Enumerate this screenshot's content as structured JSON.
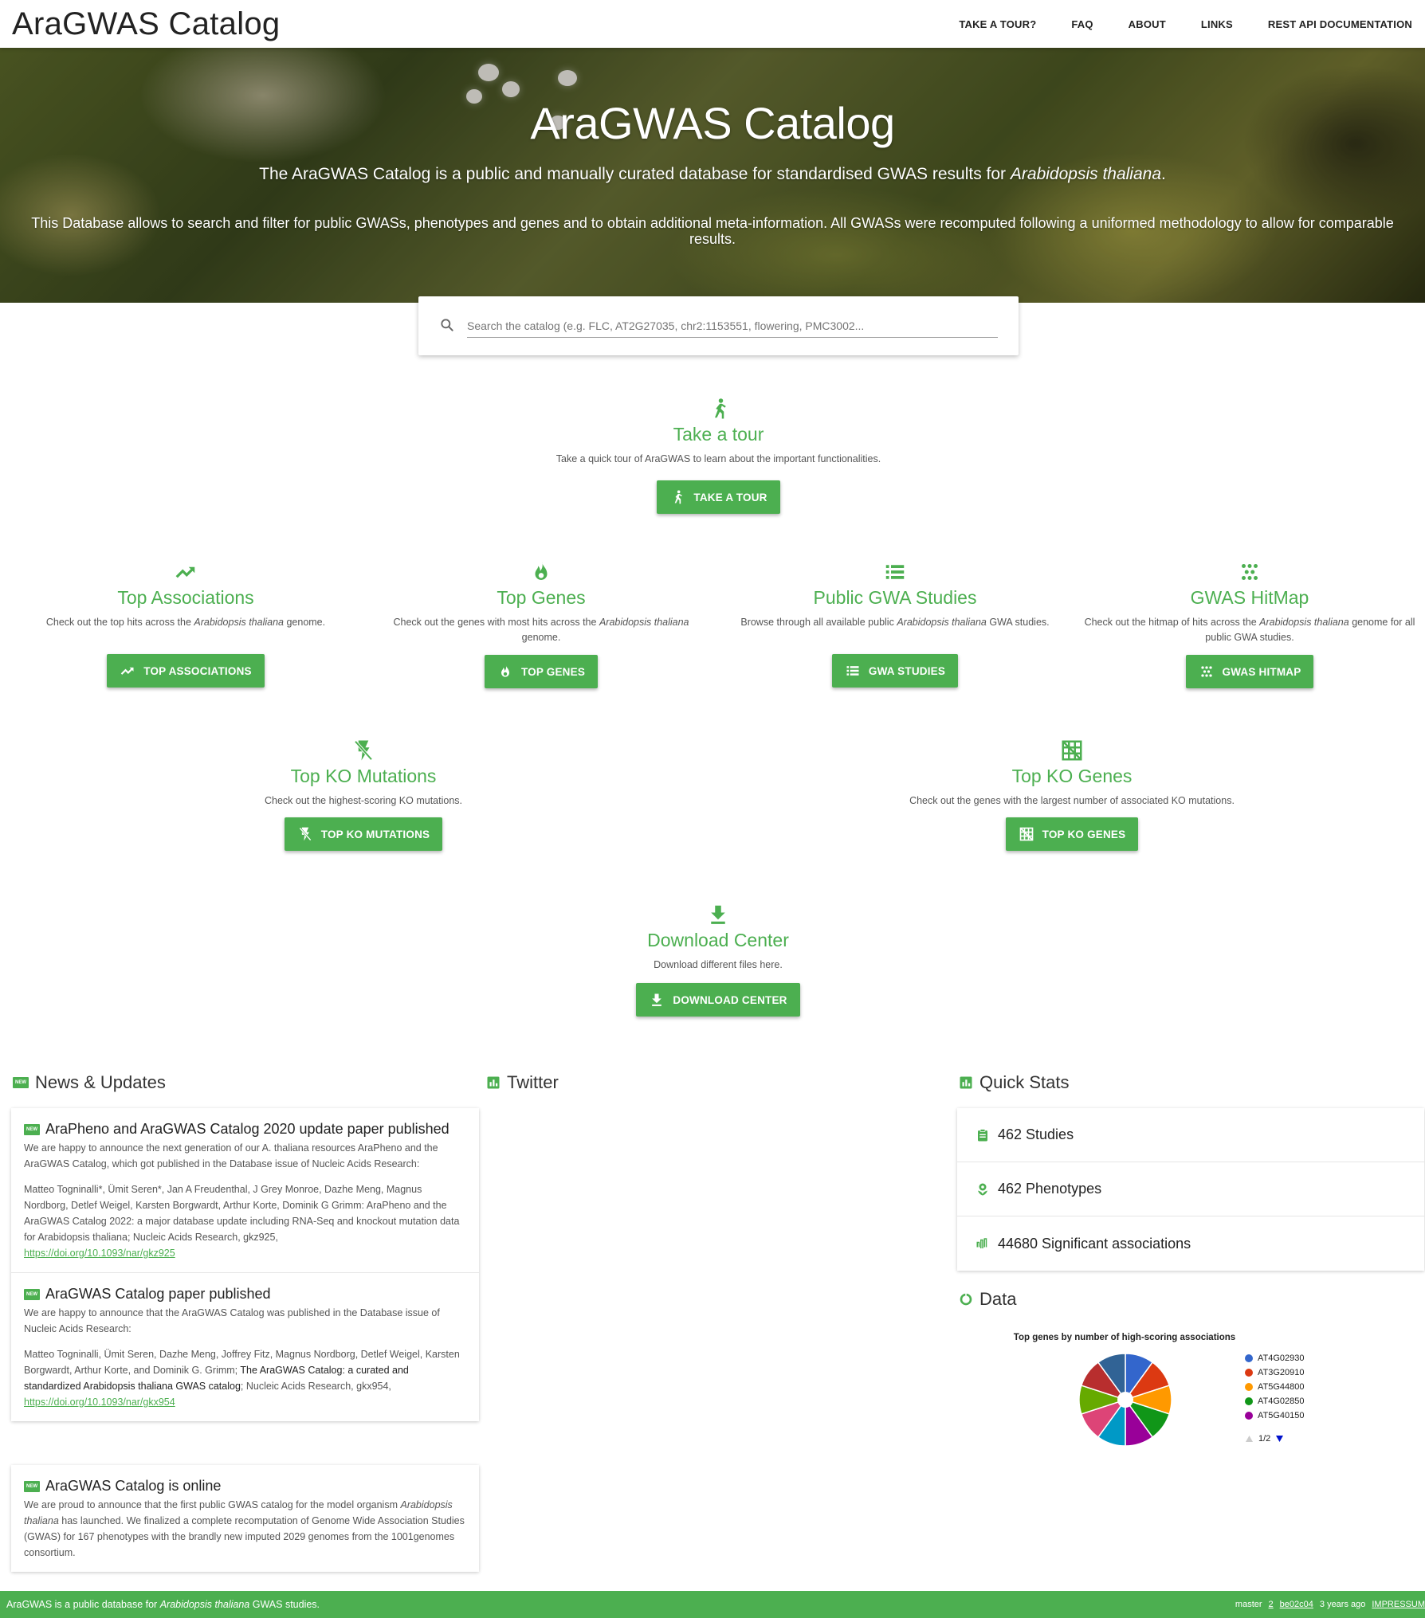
{
  "header": {
    "brand": "AraGWAS Catalog",
    "nav": [
      "TAKE A TOUR?",
      "FAQ",
      "ABOUT",
      "LINKS",
      "REST API DOCUMENTATION"
    ]
  },
  "hero": {
    "title": "AraGWAS Catalog",
    "subtitle_pre": "The AraGWAS Catalog is a public and manually curated database for standardised GWAS results for ",
    "subtitle_species": "Arabidopsis thaliana",
    "subtitle_post": ".",
    "description": "This Database allows to search and filter for public GWASs, phenotypes and genes and to obtain additional meta-information. All GWASs were recomputed following a uniformed methodology to allow for comparable results."
  },
  "search": {
    "placeholder": "Search the catalog (e.g. FLC, AT2G27035, chr2:1153551, flowering, PMC3002..."
  },
  "tour": {
    "title": "Take a tour",
    "desc": "Take a quick tour of AraGWAS to learn about the important functionalities.",
    "button": "TAKE A TOUR"
  },
  "features": [
    {
      "title": "Top Associations",
      "desc_pre": "Check out the top hits across the ",
      "desc_species": "Arabidopsis thaliana",
      "desc_post": " genome.",
      "button": "TOP ASSOCIATIONS",
      "icon": "trending-up-icon"
    },
    {
      "title": "Top Genes",
      "desc_pre": "Check out the genes with most hits across the ",
      "desc_species": "Arabidopsis thaliana",
      "desc_post": " genome.",
      "button": "TOP GENES",
      "icon": "fire-icon"
    },
    {
      "title": "Public GWA Studies",
      "desc_pre": "Browse through all available public ",
      "desc_species": "Arabidopsis thaliana",
      "desc_post": " GWA studies.",
      "button": "GWA STUDIES",
      "icon": "list-icon"
    },
    {
      "title": "GWAS HitMap",
      "desc_pre": "Check out the hitmap of hits across the ",
      "desc_species": "Arabidopsis thaliana",
      "desc_post": " genome for all public GWA studies.",
      "button": "GWAS HITMAP",
      "icon": "hitmap-icon"
    }
  ],
  "ko": [
    {
      "title": "Top KO Mutations",
      "desc": "Check out the highest-scoring KO mutations.",
      "button": "TOP KO MUTATIONS",
      "icon": "flash-off-icon"
    },
    {
      "title": "Top KO Genes",
      "desc": "Check out the genes with the largest number of associated KO mutations.",
      "button": "TOP KO GENES",
      "icon": "grid-off-icon"
    }
  ],
  "download": {
    "title": "Download Center",
    "desc": "Download different files here.",
    "button": "DOWNLOAD CENTER"
  },
  "news": {
    "heading": "News & Updates",
    "badge": "NEW",
    "items": [
      {
        "title": "AraPheno and AraGWAS Catalog 2020 update paper published",
        "intro": "We are happy to announce the next generation of our A. thaliana resources AraPheno and the AraGWAS Catalog, which got published in the Database issue of Nucleic Acids Research:",
        "citation": "Matteo Togninalli*, Ümit Seren*, Jan A Freudenthal, J Grey Monroe, Dazhe Meng, Magnus Nordborg, Detlef Weigel, Karsten Borgwardt, Arthur Korte, Dominik G Grimm: AraPheno and the AraGWAS Catalog 2022: a major database update including RNA-Seq and knockout mutation data for Arabidopsis thaliana; Nucleic Acids Research, gkz925,",
        "link": "https://doi.org/10.1093/nar/gkz925"
      },
      {
        "title": "AraGWAS Catalog paper published",
        "intro": "We are happy to announce that the AraGWAS Catalog was published in the Database issue of Nucleic Acids Research:",
        "citation_pre": "Matteo Togninalli, Ümit Seren, Dazhe Meng, Joffrey Fitz, Magnus Nordborg, Detlef Weigel, Karsten Borgwardt, Arthur Korte, and Dominik G. Grimm; ",
        "citation_title": "The AraGWAS Catalog: a curated and standardized Arabidopsis thaliana GWAS catalog",
        "citation_post": "; Nucleic Acids Research, gkx954,",
        "link": "https://doi.org/10.1093/nar/gkx954"
      },
      {
        "title": "AraGWAS Catalog is online",
        "text_pre": "We are proud to announce that the first public GWAS catalog for the model organism ",
        "text_species": "Arabidopsis thaliana",
        "text_post": " has launched. We finalized a complete recomputation of Genome Wide Association Studies (GWAS) for 167 phenotypes with the brandly new imputed 2029 genomes from the 1001genomes consortium."
      }
    ]
  },
  "twitter": {
    "heading": "Twitter"
  },
  "stats": {
    "heading": "Quick Stats",
    "studies": "462 Studies",
    "phenotypes": "462 Phenotypes",
    "associations": "44680 Significant associations"
  },
  "data_section": {
    "heading": "Data"
  },
  "chart_data": {
    "type": "pie",
    "title": "Top genes by number of high-scoring associations",
    "legend_visible": [
      "AT4G02930",
      "AT3G20910",
      "AT5G44800",
      "AT4G02850",
      "AT5G40150"
    ],
    "legend_page": "1/2",
    "legend_placement": "right",
    "slices": [
      {
        "label": "AT4G02930",
        "value": 1,
        "color": "#3366cc"
      },
      {
        "label": "AT3G20910",
        "value": 1,
        "color": "#dc3912"
      },
      {
        "label": "AT5G44800",
        "value": 1,
        "color": "#ff9900"
      },
      {
        "label": "AT4G02850",
        "value": 1,
        "color": "#109618"
      },
      {
        "label": "AT5G40150",
        "value": 1,
        "color": "#990099"
      },
      {
        "label": "",
        "value": 1,
        "color": "#0099c6"
      },
      {
        "label": "",
        "value": 1,
        "color": "#dd4477"
      },
      {
        "label": "",
        "value": 1,
        "color": "#66aa00"
      },
      {
        "label": "",
        "value": 1,
        "color": "#b82e2e"
      },
      {
        "label": "",
        "value": 1,
        "color": "#316395"
      }
    ]
  },
  "footer": {
    "left_pre": "AraGWAS is a public database for ",
    "left_species": "Arabidopsis thaliana",
    "left_post": " GWAS studies.",
    "branch": "master",
    "count": "2",
    "commit": "be02c04",
    "when": "3 years ago",
    "impressum": "IMPRESSUM"
  },
  "colors": {
    "accent": "#4caf50"
  }
}
